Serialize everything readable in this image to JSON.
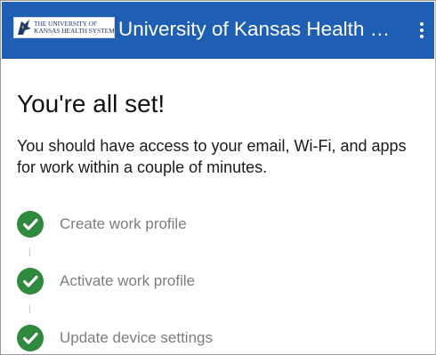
{
  "header": {
    "logo_text_line1": "THE UNIVERSITY OF",
    "logo_text_line2": "KANSAS HEALTH SYSTEM",
    "title": "University of Kansas Health System",
    "menu_icon": "more-vertical-icon"
  },
  "main": {
    "heading": "You're all set!",
    "message": "You should have access to your email, Wi-Fi, and apps for work within a couple of minutes.",
    "steps": [
      {
        "label": "Create work profile",
        "status": "complete",
        "icon": "check-circle-icon"
      },
      {
        "label": "Activate work profile",
        "status": "complete",
        "icon": "check-circle-icon"
      },
      {
        "label": "Update device settings",
        "status": "complete",
        "icon": "check-circle-icon"
      }
    ]
  },
  "colors": {
    "app_bar": "#1f5fb3",
    "check": "#2f8a3e",
    "step_text": "#7d7d7d"
  }
}
